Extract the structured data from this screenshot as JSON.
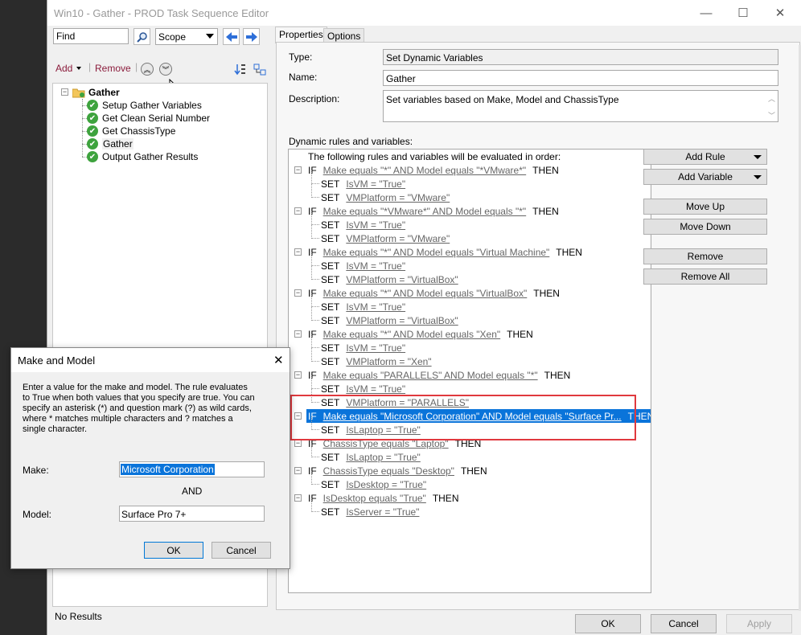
{
  "window": {
    "title": "Win10 - Gather - PROD Task Sequence Editor",
    "minimize_glyph": "—",
    "maximize_glyph": "☐",
    "close_glyph": "✕"
  },
  "toolbar": {
    "find_value": "Find",
    "scope_value": "Scope",
    "add_label": "Add",
    "remove_label": "Remove"
  },
  "tree": {
    "group_label": "Gather",
    "items": [
      {
        "label": "Setup Gather Variables",
        "selected": false
      },
      {
        "label": "Get Clean Serial Number",
        "selected": false
      },
      {
        "label": "Get ChassisType",
        "selected": false
      },
      {
        "label": "Gather",
        "selected": true
      },
      {
        "label": "Output Gather Results",
        "selected": false
      }
    ],
    "status": "No Results"
  },
  "tabs": [
    {
      "label": "Properties",
      "active": true
    },
    {
      "label": "Options",
      "active": false
    }
  ],
  "properties": {
    "type_label": "Type:",
    "type_value": "Set Dynamic Variables",
    "name_label": "Name:",
    "name_value": "Gather",
    "description_label": "Description:",
    "description_value": "Set variables based on Make, Model and ChassisType",
    "rules_label": "Dynamic rules and variables:",
    "rules_intro": "The following rules and variables will be evaluated in order:"
  },
  "rules": [
    {
      "kind": "IF",
      "text": "Make equals \"*\" AND Model equals \"*VMware*\"",
      "suffix": "THEN",
      "selected": false
    },
    {
      "kind": "SET",
      "text": "IsVM = \"True\"",
      "suffix": "",
      "selected": false
    },
    {
      "kind": "SET",
      "text": "VMPlatform = \"VMware\"",
      "suffix": "",
      "selected": false
    },
    {
      "kind": "IF",
      "text": "Make equals \"*VMware*\" AND Model equals \"*\"",
      "suffix": "THEN",
      "selected": false
    },
    {
      "kind": "SET",
      "text": "IsVM = \"True\"",
      "suffix": "",
      "selected": false
    },
    {
      "kind": "SET",
      "text": "VMPlatform = \"VMware\"",
      "suffix": "",
      "selected": false
    },
    {
      "kind": "IF",
      "text": "Make equals \"*\" AND Model equals \"Virtual Machine\"",
      "suffix": "THEN",
      "selected": false
    },
    {
      "kind": "SET",
      "text": "IsVM = \"True\"",
      "suffix": "",
      "selected": false
    },
    {
      "kind": "SET",
      "text": "VMPlatform = \"VirtualBox\"",
      "suffix": "",
      "selected": false
    },
    {
      "kind": "IF",
      "text": "Make equals \"*\" AND Model equals \"VirtualBox\"",
      "suffix": "THEN",
      "selected": false
    },
    {
      "kind": "SET",
      "text": "IsVM = \"True\"",
      "suffix": "",
      "selected": false
    },
    {
      "kind": "SET",
      "text": "VMPlatform = \"VirtualBox\"",
      "suffix": "",
      "selected": false
    },
    {
      "kind": "IF",
      "text": "Make equals \"*\" AND Model equals \"Xen\"",
      "suffix": "THEN",
      "selected": false
    },
    {
      "kind": "SET",
      "text": "IsVM = \"True\"",
      "suffix": "",
      "selected": false
    },
    {
      "kind": "SET",
      "text": "VMPlatform = \"Xen\"",
      "suffix": "",
      "selected": false
    },
    {
      "kind": "IF",
      "text": "Make equals \"PARALLELS\" AND Model equals \"*\"",
      "suffix": "THEN",
      "selected": false
    },
    {
      "kind": "SET",
      "text": "IsVM = \"True\"",
      "suffix": "",
      "selected": false
    },
    {
      "kind": "SET",
      "text": "VMPlatform = \"PARALLELS\"",
      "suffix": "",
      "selected": false
    },
    {
      "kind": "IF",
      "text": "Make equals \"Microsoft Corporation\" AND Model equals \"Surface Pr...",
      "suffix": "THEN",
      "selected": true
    },
    {
      "kind": "SET",
      "text": "IsLaptop = \"True\"",
      "suffix": "",
      "selected": false
    },
    {
      "kind": "IF",
      "text": "ChassisType equals \"Laptop\"",
      "suffix": "THEN",
      "selected": false
    },
    {
      "kind": "SET",
      "text": "IsLaptop = \"True\"",
      "suffix": "",
      "selected": false
    },
    {
      "kind": "IF",
      "text": "ChassisType equals \"Desktop\"",
      "suffix": "THEN",
      "selected": false
    },
    {
      "kind": "SET",
      "text": "IsDesktop = \"True\"",
      "suffix": "",
      "selected": false
    },
    {
      "kind": "IF",
      "text": "IsDesktop equals \"True\"",
      "suffix": "THEN",
      "selected": false
    },
    {
      "kind": "SET",
      "text": "IsServer = \"True\"",
      "suffix": "",
      "selected": false
    }
  ],
  "side_buttons": {
    "add_rule": "Add Rule",
    "add_variable": "Add Variable",
    "move_up": "Move Up",
    "move_down": "Move Down",
    "remove": "Remove",
    "remove_all": "Remove All"
  },
  "bottom_buttons": {
    "ok": "OK",
    "cancel": "Cancel",
    "apply": "Apply"
  },
  "dialog": {
    "title": "Make and Model",
    "close_glyph": "✕",
    "description": "Enter a value for the make and model. The rule evaluates to True when both values that you specify are true. You can specify an asterisk (*) and question mark (?) as wild cards, where * matches multiple characters and ? matches a single character.",
    "make_label": "Make:",
    "make_value": "Microsoft Corporation",
    "and_label": "AND",
    "model_label": "Model:",
    "model_value": "Surface Pro 7+",
    "ok_label": "OK",
    "cancel_label": "Cancel"
  },
  "colors": {
    "selection": "#0a74da",
    "highlight_annotation": "#e0393e",
    "success_icon": "#3ea33e",
    "toolbar_label": "#8b1c3c"
  }
}
